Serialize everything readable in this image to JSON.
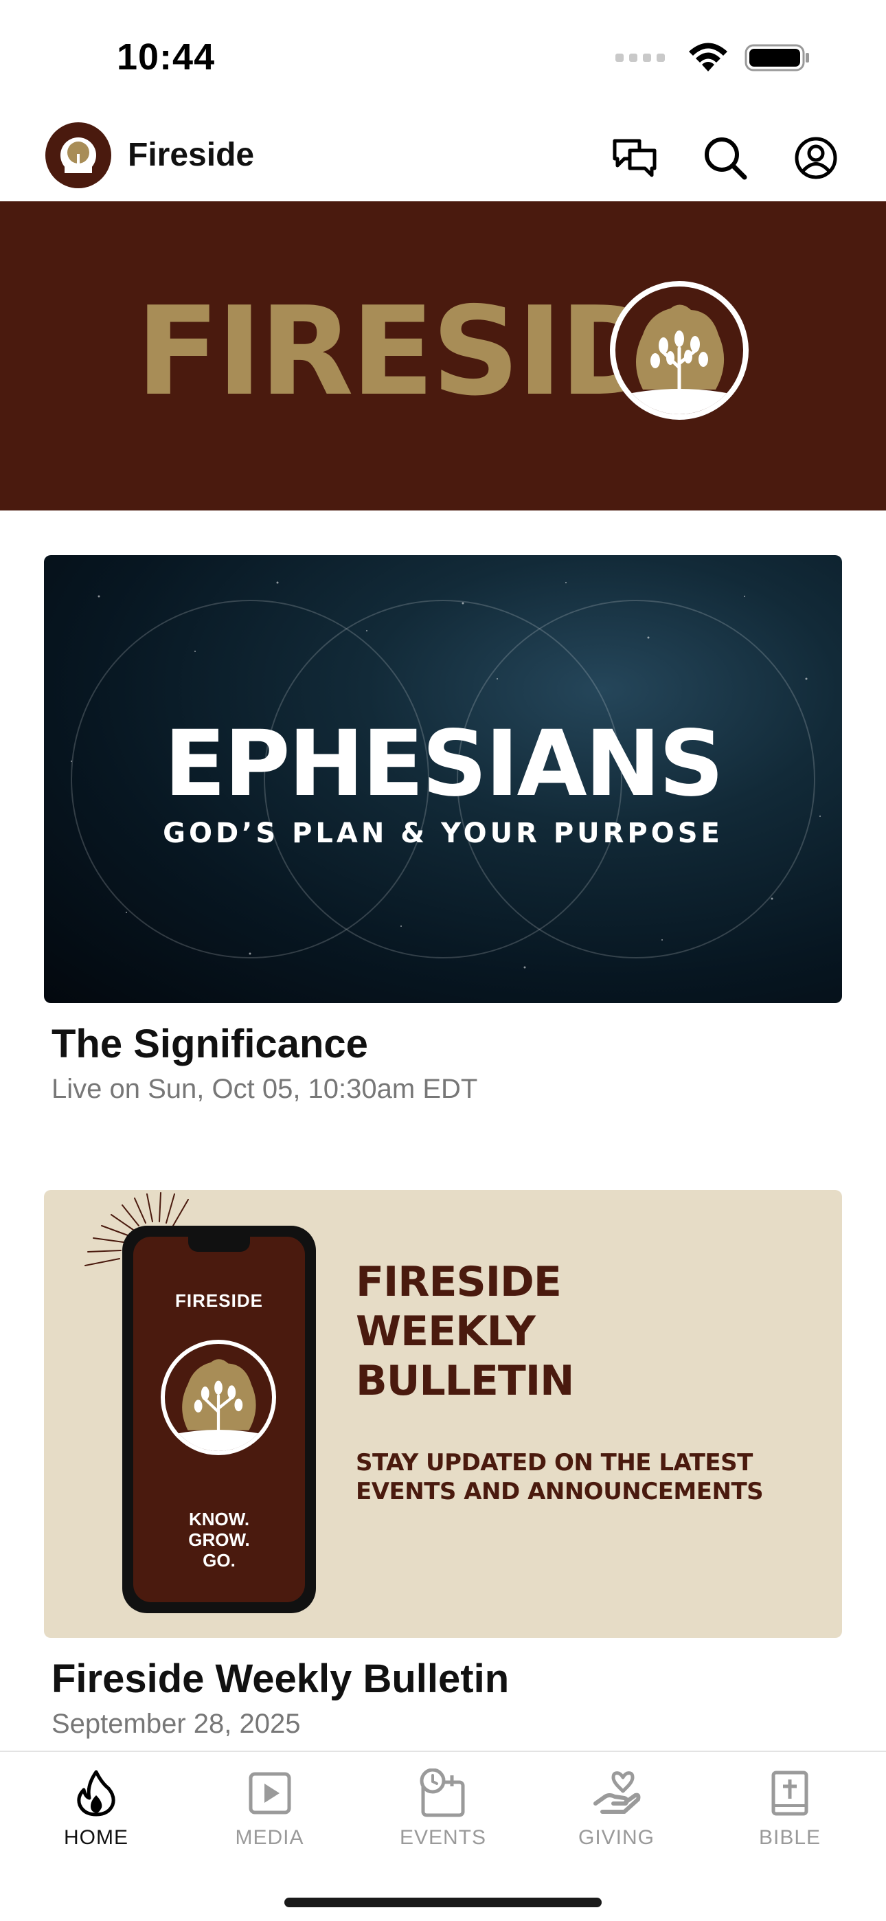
{
  "status_bar": {
    "time": "10:44"
  },
  "header": {
    "title": "Fireside"
  },
  "banner": {
    "wordmark": "FIRESIDE"
  },
  "cards": [
    {
      "image": {
        "title": "EPHESIANS",
        "subtitle": "GOD’S PLAN & YOUR PURPOSE"
      },
      "title": "The Significance",
      "subtitle": "Live on Sun, Oct 05, 10:30am EDT"
    },
    {
      "image": {
        "phone_brand": "FIRESIDE",
        "phone_motto": "KNOW.\nGROW.\nGO.",
        "heading": "FIRESIDE\nWEEKLY\nBULLETIN",
        "tagline": "STAY UPDATED ON THE LATEST\nEVENTS AND ANNOUNCEMENTS"
      },
      "title": "Fireside Weekly Bulletin",
      "subtitle": "September 28, 2025"
    }
  ],
  "tabs": [
    {
      "label": "HOME",
      "icon": "flame-icon",
      "active": true
    },
    {
      "label": "MEDIA",
      "icon": "play-icon",
      "active": false
    },
    {
      "label": "EVENTS",
      "icon": "calendar-clock-icon",
      "active": false
    },
    {
      "label": "GIVING",
      "icon": "giving-hand-icon",
      "active": false
    },
    {
      "label": "BIBLE",
      "icon": "bible-icon",
      "active": false
    }
  ],
  "colors": {
    "brand_brown": "#4a1a0e",
    "brand_gold": "#a88d57",
    "bulletin_bg": "#e6dcc6",
    "inactive_gray": "#9a9a9a"
  }
}
